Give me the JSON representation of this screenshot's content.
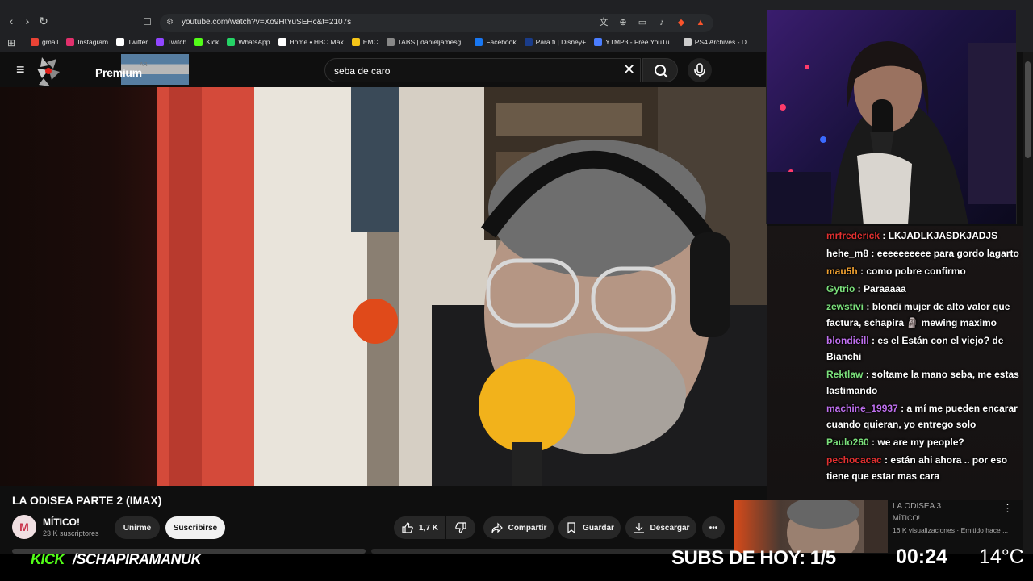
{
  "browser": {
    "url": "youtube.com/watch?v=Xo9HtYuSEHc&t=2107s",
    "bookmarks": [
      {
        "label": "gmail",
        "color": "#ea4335"
      },
      {
        "label": "Instagram",
        "color": "#e1306c"
      },
      {
        "label": "Twitter",
        "color": "#ffffff"
      },
      {
        "label": "Twitch",
        "color": "#9146ff"
      },
      {
        "label": "Kick",
        "color": "#53fc18"
      },
      {
        "label": "WhatsApp",
        "color": "#25d366"
      },
      {
        "label": "Home • HBO Max",
        "color": "#ffffff"
      },
      {
        "label": "EMC",
        "color": "#f5c518"
      },
      {
        "label": "TABS | danieljamesg...",
        "color": "#888888"
      },
      {
        "label": "Facebook",
        "color": "#1877f2"
      },
      {
        "label": "Para ti | Disney+",
        "color": "#1a3c8a"
      },
      {
        "label": "YTMP3 - Free YouTu...",
        "color": "#4a7dff"
      },
      {
        "label": "PS4 Archives - D",
        "color": "#cccccc"
      }
    ]
  },
  "youtube": {
    "premium_label": "Premium",
    "region": "AR",
    "search_value": "seba de caro"
  },
  "video": {
    "title": "LA ODISEA PARTE 2 (IMAX)",
    "channel": "MÍTICO!",
    "avatar_letter": "M",
    "subscribers": "23 K suscriptores",
    "join_label": "Unirme",
    "subscribe_label": "Suscribirse",
    "likes": "1,7 K",
    "share_label": "Compartir",
    "save_label": "Guardar",
    "download_label": "Descargar"
  },
  "recommended": {
    "title": "LA ODISEA 3",
    "channel": "MÍTICO!",
    "meta": "16 K visualizaciones · Emitido hace ..."
  },
  "chat": [
    {
      "user": "mrfrederick",
      "color": "#e23030",
      "text": "LKJADLKJASDKJADJS"
    },
    {
      "user": "hehe_m8",
      "color": "#ffffff",
      "text": "eeeeeeeeee para gordo lagarto"
    },
    {
      "user": "mau5h",
      "color": "#f0a030",
      "text": "como pobre confirmo"
    },
    {
      "user": "Gytrio",
      "color": "#7be07b",
      "text": "Paraaaaa"
    },
    {
      "user": "zewstivi",
      "color": "#7be07b",
      "text": "blondi mujer de alto valor que factura, schapira 🗿 mewing maximo"
    },
    {
      "user": "blondieill",
      "color": "#c070f0",
      "text": "es el Están con el viejo? de Bianchi"
    },
    {
      "user": "Rektlaw",
      "color": "#7be07b",
      "text": "soltame la mano seba, me estas lastimando"
    },
    {
      "user": "machine_19937",
      "color": "#c070f0",
      "text": "a mí me pueden encarar cuando quieran, yo entrego solo"
    },
    {
      "user": "Paulo260",
      "color": "#7be07b",
      "text": "we are my people?"
    },
    {
      "user": "pechocacac",
      "color": "#e23030",
      "text": "están ahi ahora .. por eso tiene que estar mas cara"
    }
  ],
  "stream": {
    "kick_label": "KICK",
    "handle": "/SCHAPIRAMANUK",
    "subs_today": "SUBS DE HOY: 1/5",
    "time": "00:24",
    "temperature": "14°C"
  },
  "colors": {
    "kick_green": "#53fc18",
    "yt_bg": "#0f0f0f"
  }
}
